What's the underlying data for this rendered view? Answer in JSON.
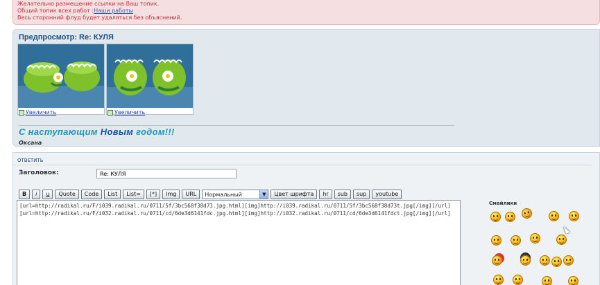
{
  "notice": {
    "line1": "Желательно размещение ссылки на Ваш топик.",
    "line2_prefix": "Общий топик всех работ :",
    "line2_link": "Наши работы",
    "line3": "Весь сторонний флуд будет удаляться без объяснений."
  },
  "preview": {
    "title": "Предпросмотр: Re: КУЛЯ",
    "thumbs": [
      {
        "enlarge_label": "Увеличить"
      },
      {
        "enlarge_label": "Увеличить"
      }
    ],
    "greeting_words": [
      "С",
      "наступающим",
      "Новым",
      "годом!!!"
    ],
    "author": "Оксана"
  },
  "reply": {
    "header": "ответить",
    "subject_label": "Заголовок:",
    "subject_value": "Re: КУЛЯ",
    "toolbar": [
      "B",
      "i",
      "u",
      "Quote",
      "Code",
      "List",
      "List=",
      "[*]",
      "Img",
      "URL"
    ],
    "size_select": "Нормальный",
    "toolbar2": [
      "Цвет шрифта",
      "hr",
      "sub",
      "sup",
      "youtube"
    ],
    "editor_text": "[url=http://radikal.ru/F/i039.radikal.ru/0711/5f/3bc568f38d73.jpg.html][img]http://i039.radikal.ru/0711/5f/3bc568f38d73t.jpg[/img][/url]\n[url=http://radikal.ru/F/i032.radikal.ru/0711/cd/6de3d6141fdc.jpg.html][img]http://i032.radikal.ru/0711/cd/6de3d6141fdct.jpg[/img][/url]",
    "smiles_title": "Смайлики",
    "smiles": [
      "smile-icon",
      "laugh-icon",
      "jester-icon",
      "grin-icon",
      "wink-icon",
      "cool-icon",
      "happy-icon",
      "duck-icon",
      "tongue-icon",
      "clown-icon",
      "pirate-icon",
      "crowd-icon",
      "angry-icon",
      "sign-icon",
      "mail-icon"
    ]
  },
  "colors": {
    "notice_bg": "#f6dfe0",
    "notice_text": "#c0303c",
    "panel_bg": "#e1e8ee",
    "title_color": "#1d4e7a",
    "greeting_color": "#1a9ab8"
  }
}
